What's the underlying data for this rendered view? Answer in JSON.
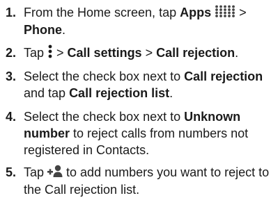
{
  "steps": [
    {
      "number": "1.",
      "t1": "From the Home screen, tap ",
      "b1": "Apps",
      "icon": "apps-grid-icon",
      "t2": " > ",
      "b2": "Phone",
      "t3": "."
    },
    {
      "number": "2.",
      "t1": "Tap ",
      "icon": "menu-dots-vertical-icon",
      "t2": " > ",
      "b1": "Call settings",
      "t3": " > ",
      "b2": "Call rejection",
      "t4": "."
    },
    {
      "number": "3.",
      "t1": "Select the check box next to ",
      "b1": "Call rejection",
      "t2": " and tap ",
      "b2": "Call rejection list",
      "t3": "."
    },
    {
      "number": "4.",
      "t1": "Select the check box next to ",
      "b1": "Unknown number",
      "t2": " to reject calls from numbers not registered in Contacts."
    },
    {
      "number": "5.",
      "t1": "Tap ",
      "icon": "add-contact-icon",
      "t2": " to add numbers you want to reject to the Call rejection list."
    }
  ],
  "colors": {
    "text": "#1a1a1a",
    "icon": "#444444"
  }
}
